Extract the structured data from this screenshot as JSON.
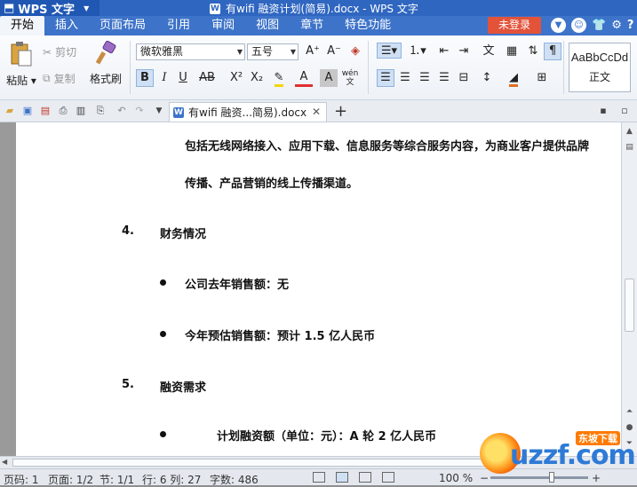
{
  "app": {
    "menu_label": "WPS 文字",
    "window_title": "有wifi 融资计划(简易).docx - WPS 文字",
    "login_label": "未登录",
    "menu_tabs": [
      "开始",
      "插入",
      "页面布局",
      "引用",
      "审阅",
      "视图",
      "章节",
      "特色功能"
    ]
  },
  "ribbon": {
    "paste_label": "粘贴",
    "cut_label": "剪切",
    "copy_label": "复制",
    "format_painter_label": "格式刷",
    "font_name": "微软雅黑",
    "font_size": "五号",
    "style_sample": "AaBbCcDd",
    "style_name": "正文",
    "bold_label": "B",
    "italic_label": "I",
    "underline_label": "U",
    "strike_label": "AB",
    "superscript_label": "X²",
    "subscript_label": "X₂",
    "grow_font_label": "A⁺",
    "shrink_font_label": "A⁻",
    "font_color_label": "A",
    "char_shade_label": "A",
    "phonetic_label": "wén"
  },
  "doc_tab": {
    "label": "有wifi 融资...简易).docx"
  },
  "document": {
    "lines": [
      "包括无线网络接入、应用下载、信息服务等综合服务内容，为商业客户提供品牌",
      "传播、产品营销的线上传播渠道。",
      "财务情况",
      "公司去年销售额：无",
      "今年预估销售额：预计 1.5 亿人民币",
      "融资需求",
      "计划融资额（单位：元）：A 轮 2 亿人民币"
    ],
    "numbers": [
      "4.",
      "5."
    ]
  },
  "statusbar": {
    "page_no": "页码: 1",
    "pages": "页面: 1/2",
    "section": "节: 1/1",
    "row_col": "行: 6  列: 27",
    "word_count": "字数: 486",
    "zoom": "100 %"
  },
  "watermark": {
    "text": "uzzf.com",
    "small_text": "东坡下载"
  },
  "colors": {
    "title_blue": "#2f66c0",
    "menu_blue": "#3d73c9",
    "login_red": "#e2533a"
  }
}
